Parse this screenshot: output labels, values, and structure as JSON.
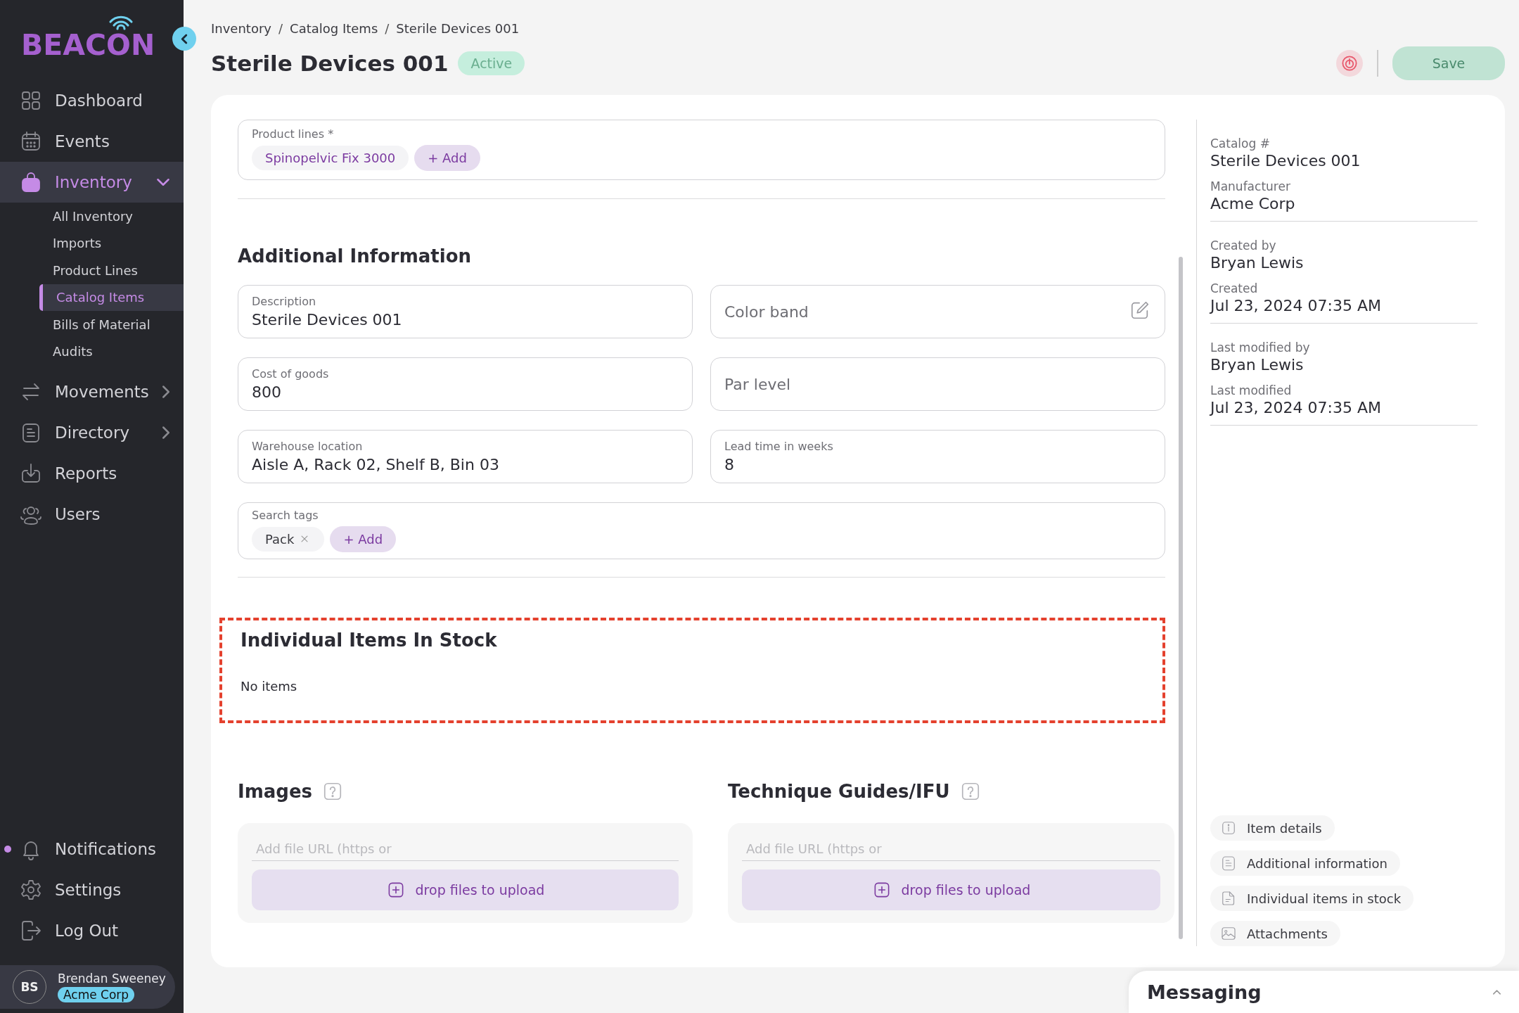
{
  "sidebar": {
    "logo": "BEACON",
    "nav": [
      {
        "label": "Dashboard",
        "selected": false
      },
      {
        "label": "Events",
        "selected": false
      },
      {
        "label": "Inventory",
        "selected": true,
        "expanded": true,
        "children": [
          {
            "label": "All Inventory",
            "selected": false
          },
          {
            "label": "Imports",
            "selected": false
          },
          {
            "label": "Product Lines",
            "selected": false
          },
          {
            "label": "Catalog Items",
            "selected": true
          },
          {
            "label": "Bills of Material",
            "selected": false
          },
          {
            "label": "Audits",
            "selected": false
          }
        ]
      },
      {
        "label": "Movements",
        "selected": false,
        "expanded": false
      },
      {
        "label": "Directory",
        "selected": false,
        "expanded": false
      },
      {
        "label": "Reports",
        "selected": false
      },
      {
        "label": "Users",
        "selected": false
      }
    ],
    "bottom_nav": [
      {
        "label": "Notifications",
        "unread": true
      },
      {
        "label": "Settings",
        "unread": false
      },
      {
        "label": "Log Out",
        "unread": false
      }
    ],
    "user": {
      "initials": "BS",
      "name": "Brendan Sweeney",
      "org": "Acme Corp"
    }
  },
  "breadcrumb": {
    "items": [
      "Inventory",
      "Catalog Items",
      "Sterile Devices 001"
    ],
    "separator": "/"
  },
  "title": "Sterile Devices 001",
  "status": "Active",
  "save_button": {
    "label": "Save",
    "disabled": true
  },
  "product_lines": {
    "label": "Product lines *",
    "tags": [
      "Spinopelvic Fix 3000"
    ],
    "add_label": "+ Add"
  },
  "additional_information": {
    "heading": "Additional Information",
    "fields": [
      {
        "kind": "filled",
        "label": "Description",
        "value": "Sterile Devices 001"
      },
      {
        "kind": "editable",
        "placeholder": "Color band"
      },
      {
        "kind": "filled",
        "label": "Cost of goods",
        "value": "800"
      },
      {
        "kind": "empty",
        "placeholder": "Par level"
      },
      {
        "kind": "filled",
        "label": "Warehouse location",
        "value": "Aisle A, Rack 02, Shelf B, Bin 03"
      },
      {
        "kind": "filled",
        "label": "Lead time in weeks",
        "value": "8"
      }
    ],
    "search_tags": {
      "label": "Search tags",
      "tags": [
        "Pack"
      ],
      "add_label": "+ Add"
    }
  },
  "stock": {
    "heading": "Individual Items In Stock",
    "empty_text": "No items",
    "highlighted": true
  },
  "attachments": [
    {
      "heading": "Images",
      "url_placeholder": "Add file URL (https or",
      "upload_label": "drop files to upload"
    },
    {
      "heading": "Technique Guides/IFU",
      "url_placeholder": "Add file URL (https or",
      "upload_label": "drop files to upload"
    }
  ],
  "details": [
    [
      {
        "label": "Catalog #",
        "value": "Sterile Devices 001"
      },
      {
        "label": "Manufacturer",
        "value": "Acme Corp"
      }
    ],
    [
      {
        "label": "Created by",
        "value": "Bryan Lewis"
      },
      {
        "label": "Created",
        "value": "Jul 23, 2024 07:35 AM"
      }
    ],
    [
      {
        "label": "Last modified by",
        "value": "Bryan Lewis"
      },
      {
        "label": "Last modified",
        "value": "Jul 23, 2024 07:35 AM"
      }
    ]
  ],
  "section_links": [
    {
      "label": "Item details"
    },
    {
      "label": "Additional information"
    },
    {
      "label": "Individual items in stock"
    },
    {
      "label": "Attachments"
    }
  ],
  "messaging": {
    "title": "Messaging",
    "expanded": false
  }
}
